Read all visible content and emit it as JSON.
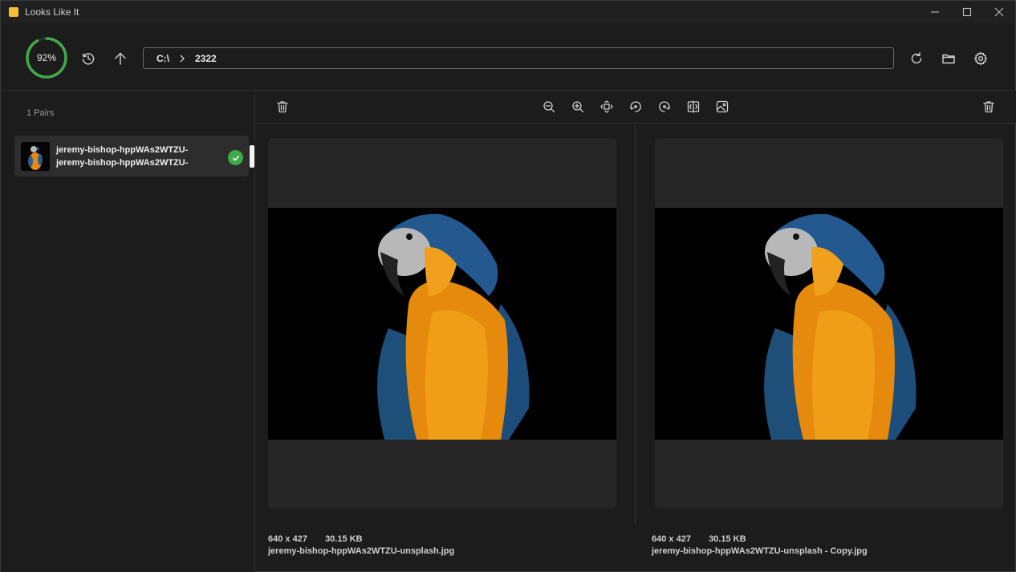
{
  "window": {
    "title": "Looks Like It"
  },
  "header": {
    "progress_percent": 92,
    "progress_label": "92%",
    "path": {
      "drive": "C:\\",
      "folder": "2322"
    }
  },
  "sidebar": {
    "pairs_label": "1 Pairs",
    "items": [
      {
        "name_top": "jeremy-bishop-hppWAs2WTZU-",
        "name_bottom": "jeremy-bishop-hppWAs2WTZU-",
        "status": "matched"
      }
    ]
  },
  "left_image": {
    "dimensions": "640 x 427",
    "size": "30.15 KB",
    "filename": "jeremy-bishop-hppWAs2WTZU-unsplash.jpg"
  },
  "right_image": {
    "dimensions": "640 x 427",
    "size": "30.15 KB",
    "filename": "jeremy-bishop-hppWAs2WTZU-unsplash - Copy.jpg"
  },
  "colors": {
    "accent_green": "#3fa94a",
    "background": "#1c1c1c",
    "panel": "#262626"
  },
  "icons": [
    "history-icon",
    "up-arrow-icon",
    "refresh-icon",
    "folder-icon",
    "settings-icon",
    "delete-icon",
    "zoom-out-icon",
    "zoom-in-icon",
    "fit-icon",
    "rotate-left-icon",
    "rotate-right-icon",
    "flip-icon",
    "image-icon"
  ]
}
